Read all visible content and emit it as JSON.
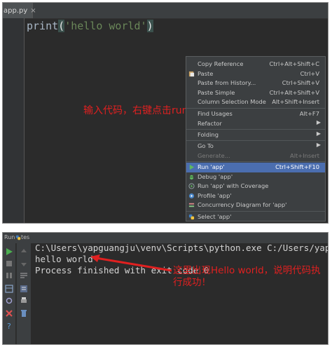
{
  "editor": {
    "tab_label": "app.py",
    "tab_close": "×",
    "code": {
      "fn": "print",
      "open": "(",
      "str": "'hello world'",
      "close": ")"
    }
  },
  "annotation_top": "输入代码，右键点击run",
  "context_menu": {
    "items": [
      {
        "label": "Copy Reference",
        "shortcut": "Ctrl+Alt+Shift+C"
      },
      {
        "label": "Paste",
        "shortcut": "Ctrl+V",
        "icon": "paste-icon"
      },
      {
        "label": "Paste from History...",
        "shortcut": "Ctrl+Shift+V"
      },
      {
        "label": "Paste Simple",
        "shortcut": "Ctrl+Alt+Shift+V"
      },
      {
        "label": "Column Selection Mode",
        "shortcut": "Alt+Shift+Insert"
      },
      {
        "label": "Find Usages",
        "shortcut": "Alt+F7"
      },
      {
        "label": "Refactor",
        "shortcut": "▶"
      },
      {
        "label": "Folding",
        "shortcut": "▶"
      },
      {
        "label": "Go To",
        "shortcut": "▶"
      },
      {
        "label": "Generate...",
        "shortcut": "Alt+Insert",
        "disabled": true
      },
      {
        "label": "Run 'app'",
        "shortcut": "Ctrl+Shift+F10",
        "icon": "run-icon",
        "selected": true
      },
      {
        "label": "Debug 'app'",
        "shortcut": "",
        "icon": "debug-icon"
      },
      {
        "label": "Run 'app' with Coverage",
        "shortcut": "",
        "icon": "coverage-icon"
      },
      {
        "label": "Profile 'app'",
        "shortcut": "",
        "icon": "profile-icon"
      },
      {
        "label": "Concurrency Diagram for 'app'",
        "shortcut": "",
        "icon": "concurrency-icon"
      },
      {
        "label": "Select 'app'",
        "shortcut": "",
        "icon": "python-icon"
      }
    ]
  },
  "run_panel": {
    "header_label": "Run",
    "tab_label": "tes",
    "console_lines": [
      "C:\\Users\\yapguangju\\venv\\Scripts\\python.exe C:/Users/yap",
      "hello world",
      "",
      "Process finished with exit code 0"
    ]
  },
  "annotation_bottom": "这里出现Hello world，说明代码执行成功！",
  "colors": {
    "editor_bg": "#2b2b2b",
    "menu_bg": "#3c3f41",
    "menu_selected": "#4b6eaf",
    "annotation": "#e02020",
    "string": "#6a8759"
  }
}
